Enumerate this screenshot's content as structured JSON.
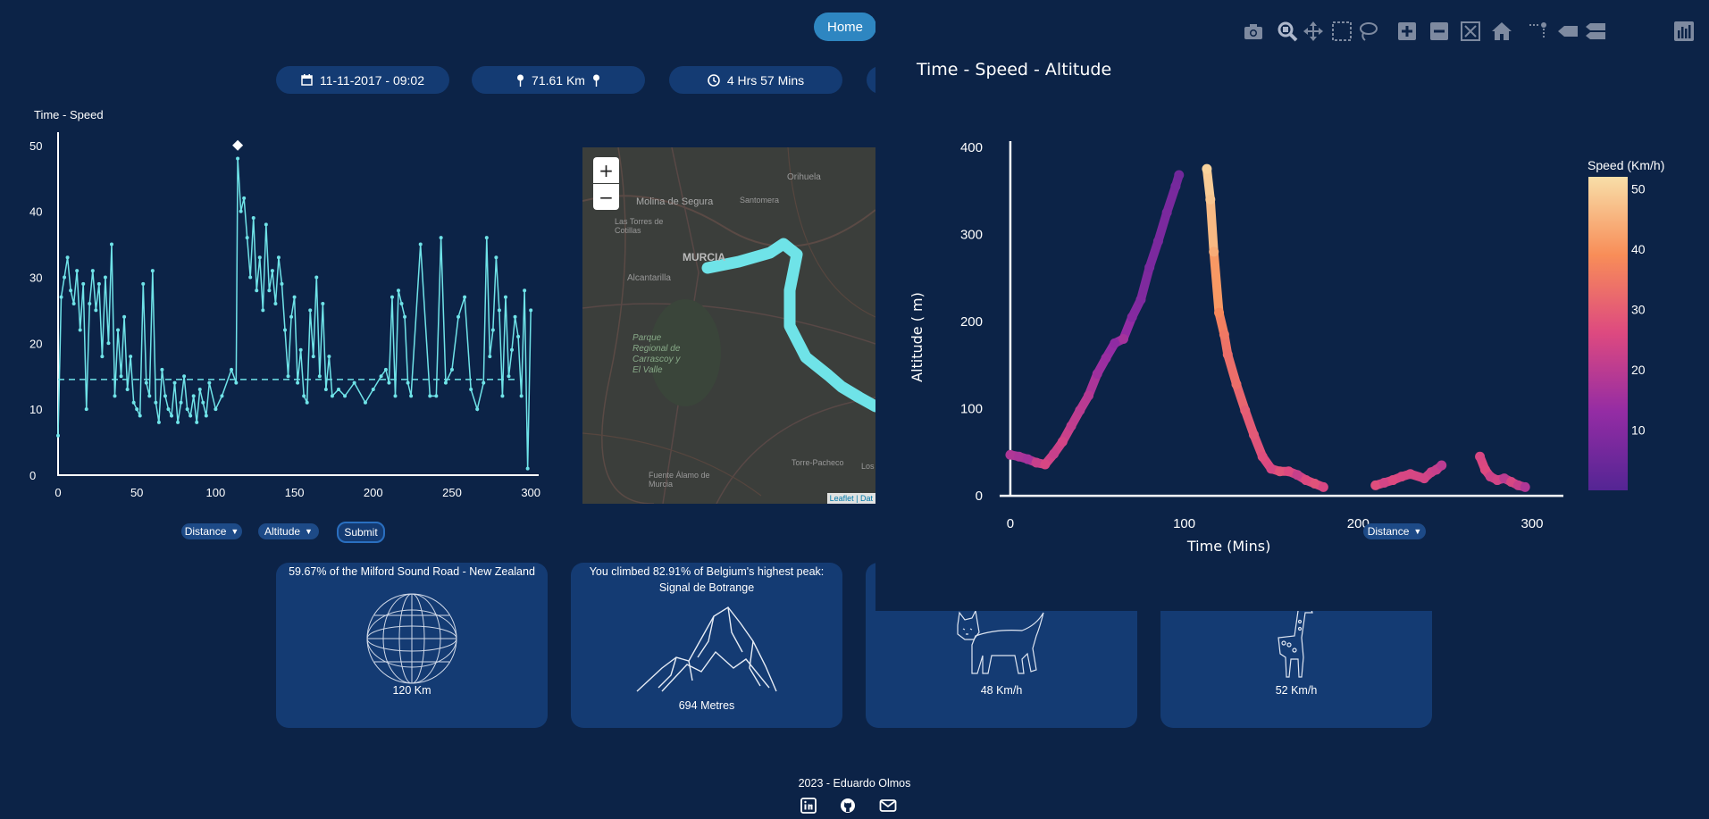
{
  "nav": {
    "home_label": "Home"
  },
  "stats": {
    "date": "11-11-2017 - 09:02",
    "distance": "71.61 Km",
    "duration": "4 Hrs 57 Mins"
  },
  "colors": {
    "background": "#0c2347",
    "card": "#143b73",
    "line": "#6fe3e8",
    "accent": "#2e86c1"
  },
  "left_chart": {
    "title": "Time - Speed",
    "x_ticks": [
      "0",
      "50",
      "100",
      "150",
      "200",
      "250",
      "300"
    ],
    "y_ticks": [
      "0",
      "10",
      "20",
      "30",
      "40",
      "50"
    ]
  },
  "controls": {
    "select_x": "Distance",
    "select_y": "Altitude",
    "submit_label": "Submit",
    "overlay_select": "Distance"
  },
  "map": {
    "labels": [
      "Orihuela",
      "Molina de Segura",
      "Santomera",
      "Las Torres de Cotillas",
      "MURCIA",
      "Alcantarilla",
      "Parque Regional de Carrascoy y El Valle",
      "Torre-Pacheco",
      "Fuente Álamo de Murcia",
      "Los"
    ],
    "attribution": "Leaflet | Dat"
  },
  "cards": [
    {
      "title": "59.67% of the Milford Sound Road - New Zealand",
      "value": "120 Km",
      "icon": "globe-icon"
    },
    {
      "title": "You climbed 82.91% of Belgium's highest peak:\nSignal de Botrange",
      "value": "694 Metres",
      "icon": "mountain-icon"
    },
    {
      "title": "",
      "value": "48 Km/h",
      "icon": "lynx-icon"
    },
    {
      "title": "",
      "value": "52 Km/h",
      "icon": "giraffe-icon"
    }
  ],
  "footer": {
    "text": "2023 - Eduardo Olmos",
    "icons": [
      "linkedin-icon",
      "github-icon",
      "mail-icon"
    ]
  },
  "chart_data": [
    {
      "type": "line",
      "title": "Time - Speed",
      "xlim": [
        0,
        305
      ],
      "ylim": [
        0,
        52
      ],
      "mean_line": 14.5,
      "max_marker": {
        "x": 114,
        "y": 50
      },
      "x": [
        0,
        2,
        4,
        6,
        8,
        10,
        12,
        14,
        16,
        18,
        20,
        22,
        24,
        26,
        28,
        30,
        32,
        34,
        36,
        38,
        40,
        42,
        44,
        46,
        48,
        50,
        52,
        54,
        56,
        58,
        60,
        62,
        64,
        66,
        68,
        70,
        72,
        74,
        76,
        78,
        80,
        82,
        84,
        86,
        88,
        90,
        92,
        94,
        96,
        100,
        104,
        110,
        113,
        114,
        116,
        118,
        120,
        122,
        124,
        126,
        128,
        130,
        132,
        134,
        136,
        138,
        140,
        142,
        144,
        146,
        148,
        150,
        152,
        154,
        156,
        158,
        160,
        162,
        164,
        166,
        168,
        170,
        172,
        174,
        178,
        182,
        188,
        195,
        200,
        205,
        208,
        210,
        212,
        214,
        216,
        218,
        220,
        222,
        224,
        230,
        236,
        240,
        243,
        246,
        250,
        254,
        258,
        262,
        266,
        270,
        272,
        274,
        276,
        278,
        280,
        282,
        284,
        286,
        288,
        290,
        292,
        294,
        296,
        298,
        300
      ],
      "y": [
        6,
        27,
        30,
        33,
        28,
        26,
        31,
        22,
        29,
        10,
        26,
        31,
        25,
        29,
        18,
        30,
        20,
        35,
        12,
        22,
        15,
        24,
        13,
        18,
        11,
        10,
        9,
        29,
        14,
        12,
        31,
        11,
        8,
        16,
        12,
        10,
        9,
        14,
        8,
        11,
        15,
        10,
        9,
        12,
        8,
        13,
        11,
        9,
        14,
        10,
        12,
        16,
        14,
        48,
        40,
        42,
        36,
        30,
        39,
        28,
        33,
        25,
        38,
        28,
        31,
        26,
        33,
        29,
        22,
        15,
        24,
        27,
        14,
        19,
        12,
        11,
        25,
        18,
        30,
        15,
        26,
        13,
        18,
        12,
        13,
        12,
        14,
        11,
        13,
        15,
        16,
        14,
        27,
        12,
        28,
        26,
        24,
        14,
        12,
        35,
        12,
        12,
        36,
        14,
        16,
        24,
        27,
        13,
        10,
        14,
        36,
        18,
        22,
        33,
        25,
        12,
        27,
        15,
        19,
        24,
        21,
        12,
        28,
        1,
        25
      ]
    },
    {
      "type": "scatter",
      "title": "Time - Speed - Altitude",
      "xlabel": "Time (Mins)",
      "ylabel": "Altitude ( m)",
      "xlim": [
        -20,
        318
      ],
      "ylim": [
        -5,
        410
      ],
      "x_ticks": [
        "0",
        "100",
        "200",
        "300"
      ],
      "y_ticks": [
        "0",
        "100",
        "200",
        "300",
        "400"
      ],
      "colorbar": {
        "title": "Speed (Km/h)",
        "ticks": [
          "10",
          "20",
          "30",
          "40",
          "50"
        ],
        "range": [
          0,
          52
        ]
      },
      "x": [
        0,
        5,
        10,
        15,
        20,
        25,
        30,
        35,
        40,
        45,
        50,
        55,
        60,
        65,
        70,
        75,
        80,
        85,
        90,
        95,
        97,
        113,
        115,
        117,
        120,
        123,
        125,
        130,
        135,
        140,
        145,
        150,
        155,
        160,
        165,
        170,
        175,
        180,
        210,
        215,
        220,
        225,
        230,
        238,
        242,
        245,
        248,
        270,
        273,
        276,
        280,
        284,
        288,
        292,
        296
      ],
      "y": [
        47,
        45,
        42,
        38,
        36,
        48,
        62,
        80,
        98,
        115,
        140,
        158,
        175,
        180,
        205,
        225,
        262,
        292,
        325,
        355,
        368,
        375,
        340,
        280,
        210,
        185,
        162,
        128,
        98,
        70,
        45,
        31,
        28,
        28,
        24,
        18,
        14,
        10,
        12,
        15,
        18,
        22,
        25,
        20,
        27,
        30,
        35,
        45,
        30,
        22,
        18,
        20,
        16,
        12,
        10
      ],
      "speed": [
        18,
        17,
        16,
        22,
        25,
        22,
        24,
        21,
        20,
        19,
        15,
        14,
        12,
        16,
        10,
        9,
        8,
        8,
        8,
        7,
        6,
        50,
        48,
        44,
        38,
        35,
        33,
        33,
        30,
        29,
        27,
        25,
        28,
        26,
        22,
        26,
        28,
        25,
        27,
        24,
        26,
        25,
        25,
        24,
        23,
        22,
        20,
        25,
        26,
        23,
        24,
        20,
        25,
        22,
        18
      ]
    }
  ]
}
